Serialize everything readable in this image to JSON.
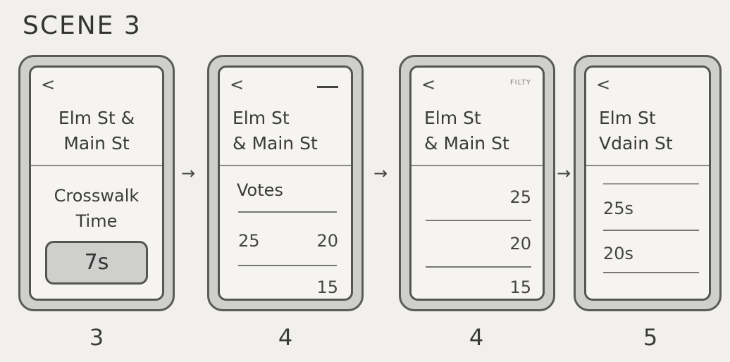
{
  "scene_title": "SCENE 3",
  "arrow": "→",
  "screens": [
    {
      "back": "<",
      "header_line1": "Elm St &",
      "header_line2": "Main St",
      "section_line1": "Crosswalk",
      "section_line2": "Time",
      "button_value": "7s",
      "step": "3"
    },
    {
      "back": "<",
      "header_line1": "Elm St",
      "header_line2": "& Main St",
      "section_label": "Votes",
      "left_value": "25",
      "right_value_1": "20",
      "right_value_2": "15",
      "step": "4"
    },
    {
      "back": "<",
      "filter_label": "FILTY",
      "header_line1": "Elm St",
      "header_line2": "& Main St",
      "values": [
        "25",
        "20",
        "15"
      ],
      "step": "4"
    },
    {
      "back": "<",
      "header_line1": "Elm St",
      "header_line2": "Vdain St",
      "values": [
        "25s",
        "20s"
      ],
      "step": "5"
    }
  ]
}
